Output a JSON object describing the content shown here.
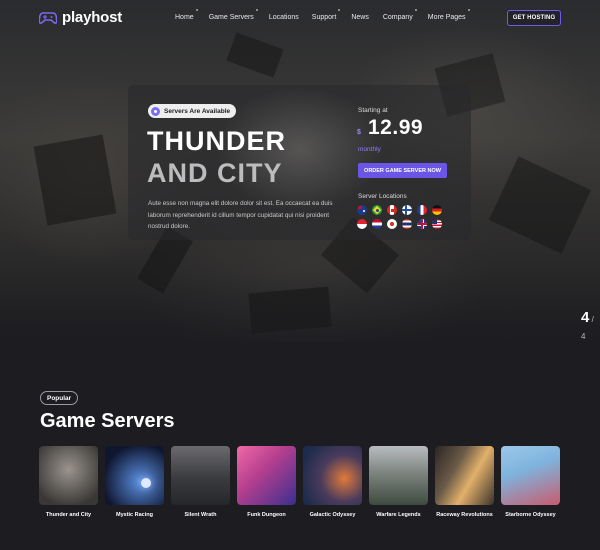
{
  "nav": {
    "logo_text": "playhost",
    "menu": [
      {
        "label": "Home",
        "has_dot": true
      },
      {
        "label": "Game Servers",
        "has_dot": true
      },
      {
        "label": "Locations",
        "has_dot": false
      },
      {
        "label": "Support",
        "has_dot": true
      },
      {
        "label": "News",
        "has_dot": false
      },
      {
        "label": "Company",
        "has_dot": true
      },
      {
        "label": "More Pages",
        "has_dot": true
      }
    ],
    "cta": "GET HOSTING"
  },
  "hero": {
    "badge": "Servers Are Available",
    "title_line1": "THUNDER",
    "title_line2": "AND CITY",
    "description": "Aute esse non magna elit dolore dolor sit est. Ea occaecat ea duis laborum reprehenderit id cillum tempor cupidatat qui nisi proident nostrud dolore.",
    "price_label": "Starting at",
    "currency": "$",
    "price": "12.99",
    "period": "monthly",
    "order_button": "ORDER GAME SERVER NOW",
    "locations_label": "Server Locations",
    "flags": [
      "australia-flag",
      "brazil-flag",
      "canada-flag",
      "finland-flag",
      "france-flag",
      "germany-flag",
      "indonesia-flag",
      "netherlands-flag",
      "japan-flag",
      "thailand-flag",
      "uk-flag",
      "usa-flag"
    ],
    "slide_current": "4",
    "slide_total": "/ 4"
  },
  "section": {
    "pill": "Popular",
    "title": "Game Servers",
    "games": [
      {
        "name": "Thunder and City",
        "c1": "#9a948d",
        "c2": "#3a3836"
      },
      {
        "name": "Mystic Racing",
        "c1": "#3b5fb5",
        "c2": "#0f1630"
      },
      {
        "name": "Silent Wrath",
        "c1": "#5d5e62",
        "c2": "#26272b"
      },
      {
        "name": "Funk Dungeon",
        "c1": "#e0509a",
        "c2": "#3b2f8f"
      },
      {
        "name": "Galactic Odyssey",
        "c1": "#c4652f",
        "c2": "#1d2b4c"
      },
      {
        "name": "Warfare Legends",
        "c1": "#a9adb0",
        "c2": "#3e4a40"
      },
      {
        "name": "Raceway Revolutions",
        "c1": "#d9a25a",
        "c2": "#2b2622"
      },
      {
        "name": "Starborne Odyssey",
        "c1": "#7fb3dd",
        "c2": "#c95b6e"
      }
    ]
  },
  "colors": {
    "accent": "#6b55e6",
    "background": "#1c1c21"
  }
}
